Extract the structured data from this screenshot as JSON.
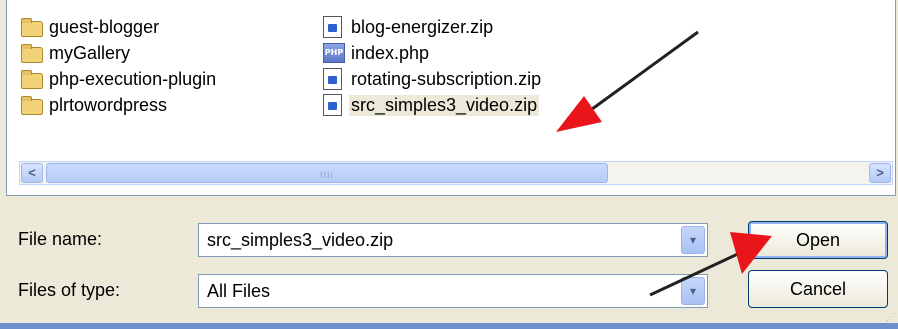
{
  "folders": [
    {
      "name": "guest-blogger"
    },
    {
      "name": "myGallery"
    },
    {
      "name": "php-execution-plugin"
    },
    {
      "name": "plrtowordpress"
    }
  ],
  "files": [
    {
      "name": "blog-energizer.zip",
      "icon": "zip-file-icon"
    },
    {
      "name": "index.php",
      "icon": "php-file-icon"
    },
    {
      "name": "rotating-subscription.zip",
      "icon": "zip-file-icon"
    },
    {
      "name": "src_simples3_video.zip",
      "icon": "zip-file-icon",
      "selected": true
    }
  ],
  "file_name": {
    "label": "File name:",
    "value": "src_simples3_video.zip"
  },
  "files_of_type": {
    "label": "Files of type:",
    "value": "All Files"
  },
  "buttons": {
    "open": "Open",
    "cancel": "Cancel"
  },
  "scroll": {
    "left_arrow": "<",
    "right_arrow": ">",
    "grip": "IIII",
    "dropdown_arrow": "▾"
  },
  "colors": {
    "annotation_arrow": "#e8161b",
    "selection_bg": "#ece9d8",
    "dialog_bg": "#ece9d8"
  }
}
